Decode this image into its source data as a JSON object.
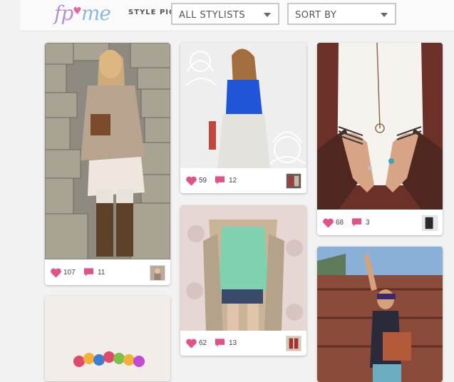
{
  "header": {
    "logo": {
      "fp": "fp",
      "me": "me"
    },
    "tagline": "STYLE PICS",
    "stylists_dropdown": "ALL STYLISTS",
    "sort_dropdown": "SORT BY"
  },
  "colors": {
    "heart": "#e0528a",
    "comment": "#e0528a",
    "accent": "#b98fd0"
  },
  "posts": [
    {
      "likes": "107",
      "comments": "11"
    },
    {
      "likes": "59",
      "comments": "12"
    },
    {
      "likes": "62",
      "comments": "13"
    },
    {
      "likes": "68",
      "comments": "3"
    }
  ]
}
